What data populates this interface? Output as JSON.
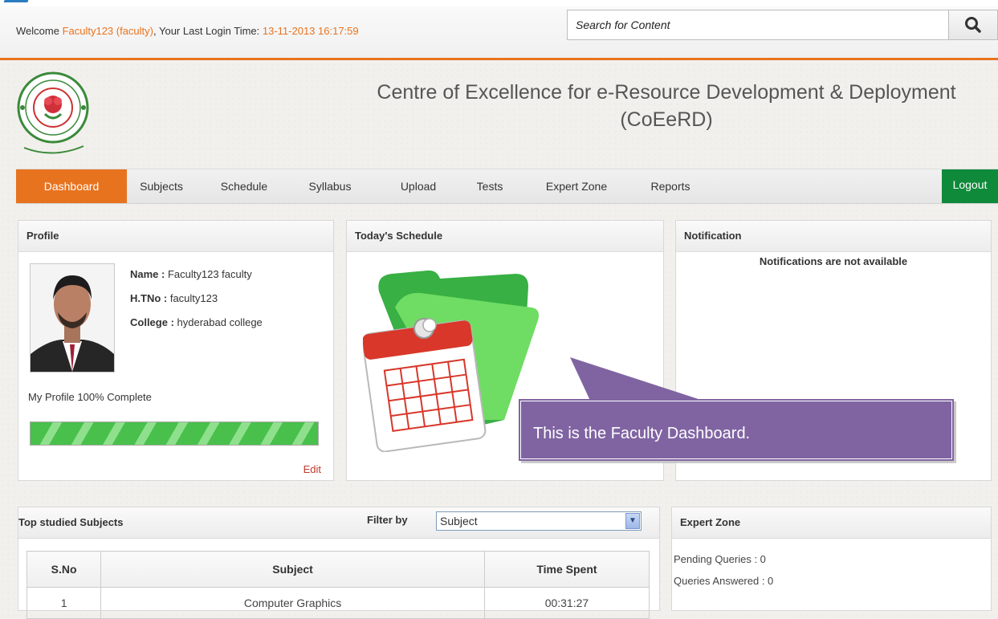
{
  "header": {
    "welcome_prefix": "Welcome ",
    "user": "Faculty123 (faculty)",
    "last_login_label": ", Your Last Login Time: ",
    "last_login_time": "13-11-2013 16:17:59",
    "search_placeholder": "Search for Content"
  },
  "site": {
    "title_line1": "Centre of Excellence for e-Resource Development & Deployment",
    "title_line2": "(CoEeRD)"
  },
  "nav": {
    "items": [
      "Dashboard",
      "Subjects",
      "Schedule",
      "Syllabus",
      "Upload",
      "Tests",
      "Expert Zone",
      "Reports"
    ],
    "logout": "Logout"
  },
  "profile": {
    "heading": "Profile",
    "name_label": "Name :",
    "name": "Faculty123 faculty",
    "htno_label": "H.TNo :",
    "htno": "faculty123",
    "college_label": "College :",
    "college": "hyderabad college",
    "completion_text": "My Profile 100% Complete",
    "completion": 1.0,
    "edit": "Edit"
  },
  "schedule": {
    "heading": "Today's Schedule"
  },
  "notification": {
    "heading": "Notification",
    "message": "Notifications are not available"
  },
  "callout": {
    "text": "This is the Faculty Dashboard."
  },
  "subjects": {
    "heading": "Top studied Subjects",
    "filter_label": "Filter by",
    "filter_value": "Subject",
    "columns": [
      "S.No",
      "Subject",
      "Time Spent"
    ],
    "rows": [
      [
        "1",
        "Computer Graphics",
        "00:31:27"
      ]
    ]
  },
  "expert_zone": {
    "heading": "Expert Zone",
    "pending": "Pending Queries : 0",
    "answered": "Queries Answered : 0"
  },
  "colors": {
    "accent": "#e8731f",
    "logout": "#0f8a3a",
    "callout": "#8064a2"
  }
}
